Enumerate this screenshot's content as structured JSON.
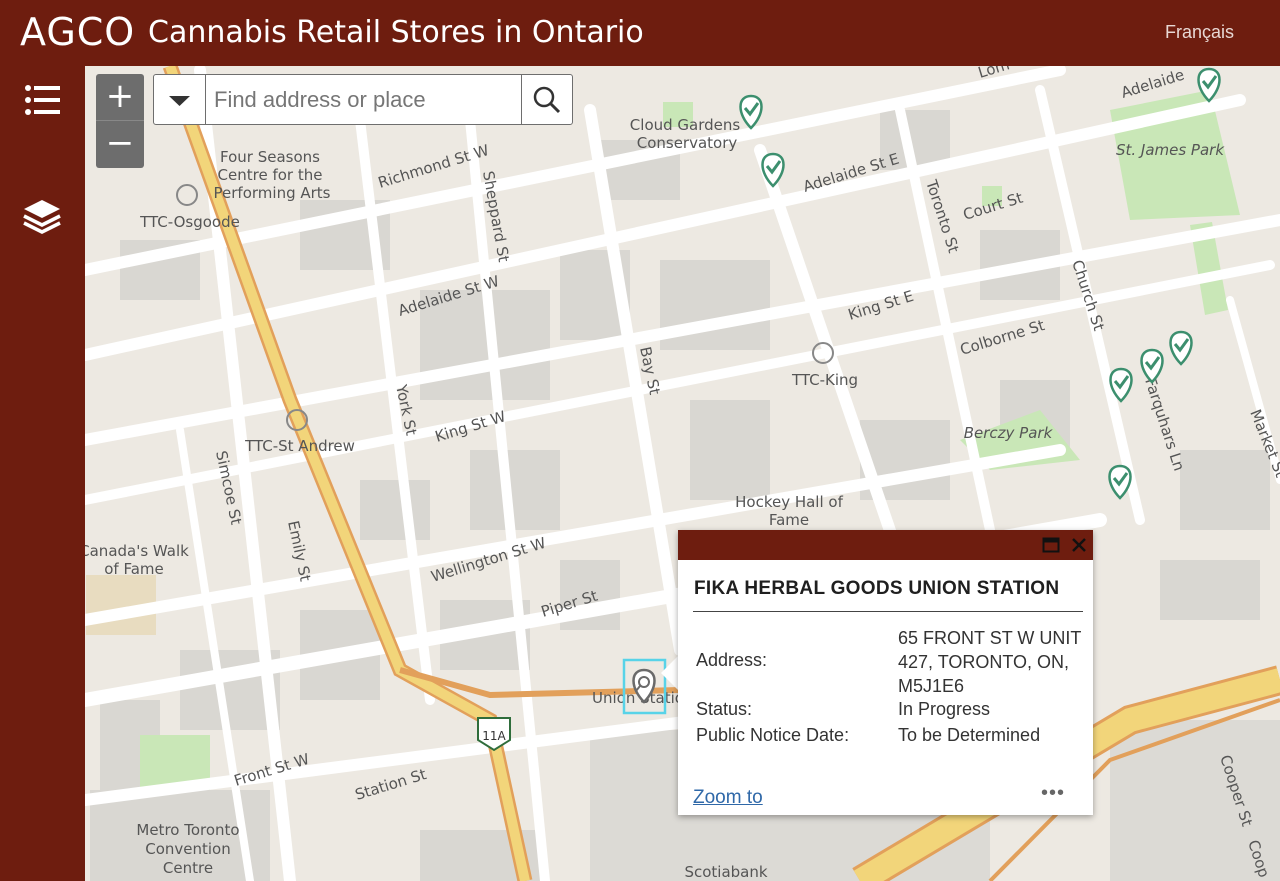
{
  "header": {
    "brand": "AGCO",
    "title": "Cannabis Retail Stores in Ontario",
    "language_link": "Français"
  },
  "search": {
    "placeholder": "Find address or place"
  },
  "zoom": {
    "in_label": "+",
    "out_label": "−"
  },
  "map_labels": {
    "richmond": "Richmond St W",
    "adelaide_w": "Adelaide St W",
    "adelaide_e": "Adelaide St E",
    "adelaide_top": "Adelaide",
    "king_w": "King St W",
    "king_e": "King St E",
    "wellington": "Wellington St W",
    "front": "Front St W",
    "station": "Station St",
    "piper": "Piper St",
    "colborne": "Colborne St",
    "court": "Court St",
    "sheppard": "Sheppard St",
    "york": "York St",
    "bay": "Bay St",
    "simcoe": "Simcoe St",
    "emily": "Emily St",
    "toronto_st": "Toronto St",
    "church": "Church St",
    "farquhars": "Farquhars Ln",
    "market": "Market St",
    "cooper": "Cooper St",
    "cooper2": "Coop",
    "four_seasons_1": "Four Seasons",
    "four_seasons_2": "Centre for the",
    "four_seasons_3": "Performing Arts",
    "ttc_osgoode": "TTC-Osgoode",
    "ttc_king": "TTC-King",
    "ttc_st_andrew": "TTC-St Andrew",
    "cloud_gardens_1": "Cloud Gardens",
    "cloud_gardens_2": "Conservatory",
    "st_james": "St. James Park",
    "berczy": "Berczy Park",
    "hockey_1": "Hockey Hall of",
    "hockey_2": "Fame",
    "canadas_walk_1": "Canada's Walk",
    "canadas_walk_2": "of Fame",
    "union": "Union Statio",
    "metro_1": "Metro Toronto",
    "metro_2": "Convention",
    "metro_3": "Centre",
    "scotiabank": "Scotiabank",
    "highway_shield": "11A",
    "lom": "Lom"
  },
  "popup": {
    "title": "FIKA HERBAL GOODS UNION STATION",
    "fields": [
      {
        "label": "Address:",
        "value": "65 FRONT ST W UNIT 427, TORONTO, ON, M5J1E6"
      },
      {
        "label": "Status:",
        "value": "In Progress"
      },
      {
        "label": "Public Notice Date:",
        "value": "To be Determined"
      }
    ],
    "zoom_to": "Zoom to",
    "more": "•••"
  },
  "colors": {
    "brand": "#6e1d0f",
    "marker": "#3c8f6e",
    "park": "#c9e7b7",
    "highway": "#f2d57a"
  }
}
